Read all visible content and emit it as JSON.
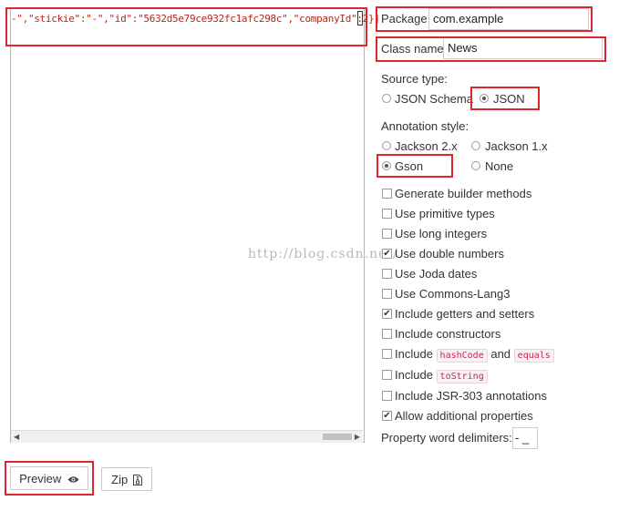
{
  "editor": {
    "json_text": "-\",\"stickie\":\"-\",\"id\":\"5632d5e79ce932fc1afc298c\",\"companyId\":2}]"
  },
  "watermark": "http://blog.csdn.net/",
  "package": {
    "label": "Package",
    "value": "com.example"
  },
  "class_name": {
    "label": "Class name",
    "value": "News"
  },
  "source_type": {
    "label": "Source type:",
    "options": [
      {
        "label": "JSON Schema",
        "selected": false
      },
      {
        "label": "JSON",
        "selected": true
      }
    ]
  },
  "annotation_style": {
    "label": "Annotation style:",
    "options": [
      {
        "label": "Jackson 2.x",
        "selected": false
      },
      {
        "label": "Jackson 1.x",
        "selected": false
      },
      {
        "label": "Gson",
        "selected": true
      },
      {
        "label": "None",
        "selected": false
      }
    ]
  },
  "options": {
    "generate_builder": {
      "label": "Generate builder methods",
      "checked": false
    },
    "primitive_types": {
      "label": "Use primitive types",
      "checked": false
    },
    "long_integers": {
      "label": "Use long integers",
      "checked": false
    },
    "double_numbers": {
      "label": "Use double numbers",
      "checked": true
    },
    "joda_dates": {
      "label": "Use Joda dates",
      "checked": false
    },
    "commons_lang3": {
      "label": "Use Commons-Lang3",
      "checked": false
    },
    "getters_setters": {
      "label": "Include getters and setters",
      "checked": true
    },
    "constructors": {
      "label": "Include constructors",
      "checked": false
    },
    "hashcode_equals": {
      "prefix": "Include",
      "code1": "hashCode",
      "mid": "and",
      "code2": "equals",
      "checked": false
    },
    "tostring": {
      "prefix": "Include",
      "code": "toString",
      "checked": false
    },
    "jsr303": {
      "label": "Include JSR-303 annotations",
      "checked": false
    },
    "additional_props": {
      "label": "Allow additional properties",
      "checked": true
    }
  },
  "delimiters": {
    "label": "Property word delimiters:",
    "value": "- _"
  },
  "buttons": {
    "preview": "Preview",
    "zip": "Zip"
  },
  "icons": {
    "preview": "eye-icon",
    "zip": "archive-file-icon",
    "check": "✔"
  }
}
